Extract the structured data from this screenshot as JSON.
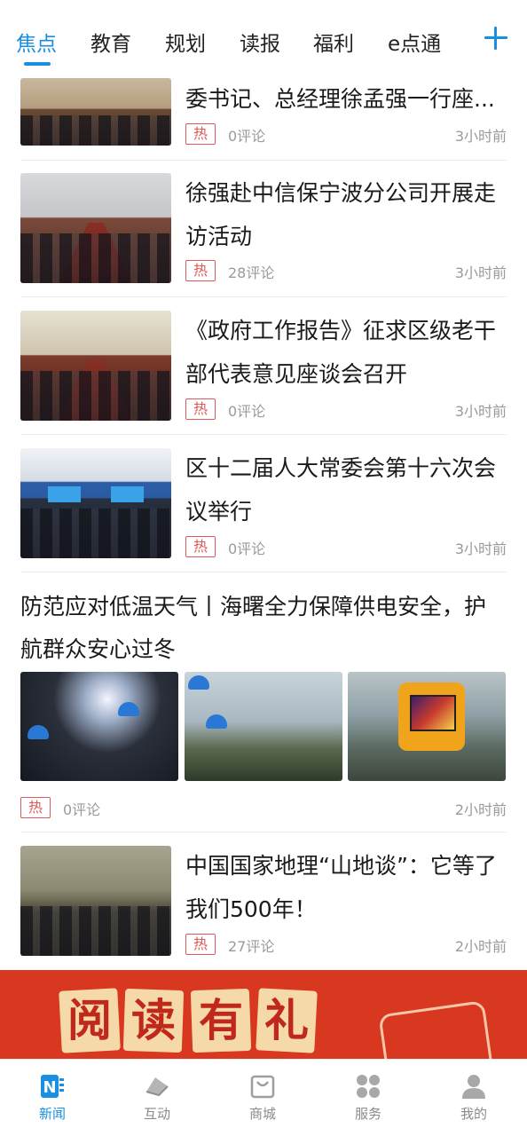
{
  "tabs": {
    "items": [
      "焦点",
      "教育",
      "规划",
      "读报",
      "福利",
      "e点通"
    ],
    "active_index": 0
  },
  "news": [
    {
      "title": "委书记、总经理徐孟强一行座...",
      "hot_label": "热",
      "comments": "0评论",
      "time": "3小时前"
    },
    {
      "title": "徐强赴中信保宁波分公司开展走访活动",
      "hot_label": "热",
      "comments": "28评论",
      "time": "3小时前"
    },
    {
      "title": "《政府工作报告》征求区级老干部代表意见座谈会召开",
      "hot_label": "热",
      "comments": "0评论",
      "time": "3小时前"
    },
    {
      "title": "区十二届人大常委会第十六次会议举行",
      "hot_label": "热",
      "comments": "0评论",
      "time": "3小时前"
    }
  ],
  "feature": {
    "title": "防范应对低温天气丨海曙全力保障供电安全，护航群众安心过冬",
    "hot_label": "热",
    "comments": "0评论",
    "time": "2小时前"
  },
  "news_last": {
    "title": "中国国家地理“山地谈”：它等了我们500年！",
    "hot_label": "热",
    "comments": "27评论",
    "time": "2小时前"
  },
  "banner": {
    "chars": [
      "阅",
      "读",
      "有",
      "礼"
    ]
  },
  "bottom_nav": {
    "items": [
      {
        "label": "新闻",
        "icon": "news-icon"
      },
      {
        "label": "互动",
        "icon": "interact-icon"
      },
      {
        "label": "商城",
        "icon": "shop-icon"
      },
      {
        "label": "服务",
        "icon": "service-icon"
      },
      {
        "label": "我的",
        "icon": "profile-icon"
      }
    ],
    "active_index": 0
  },
  "colors": {
    "accent": "#1a8fe0",
    "hot": "#e05858",
    "banner": "#d8381f"
  }
}
